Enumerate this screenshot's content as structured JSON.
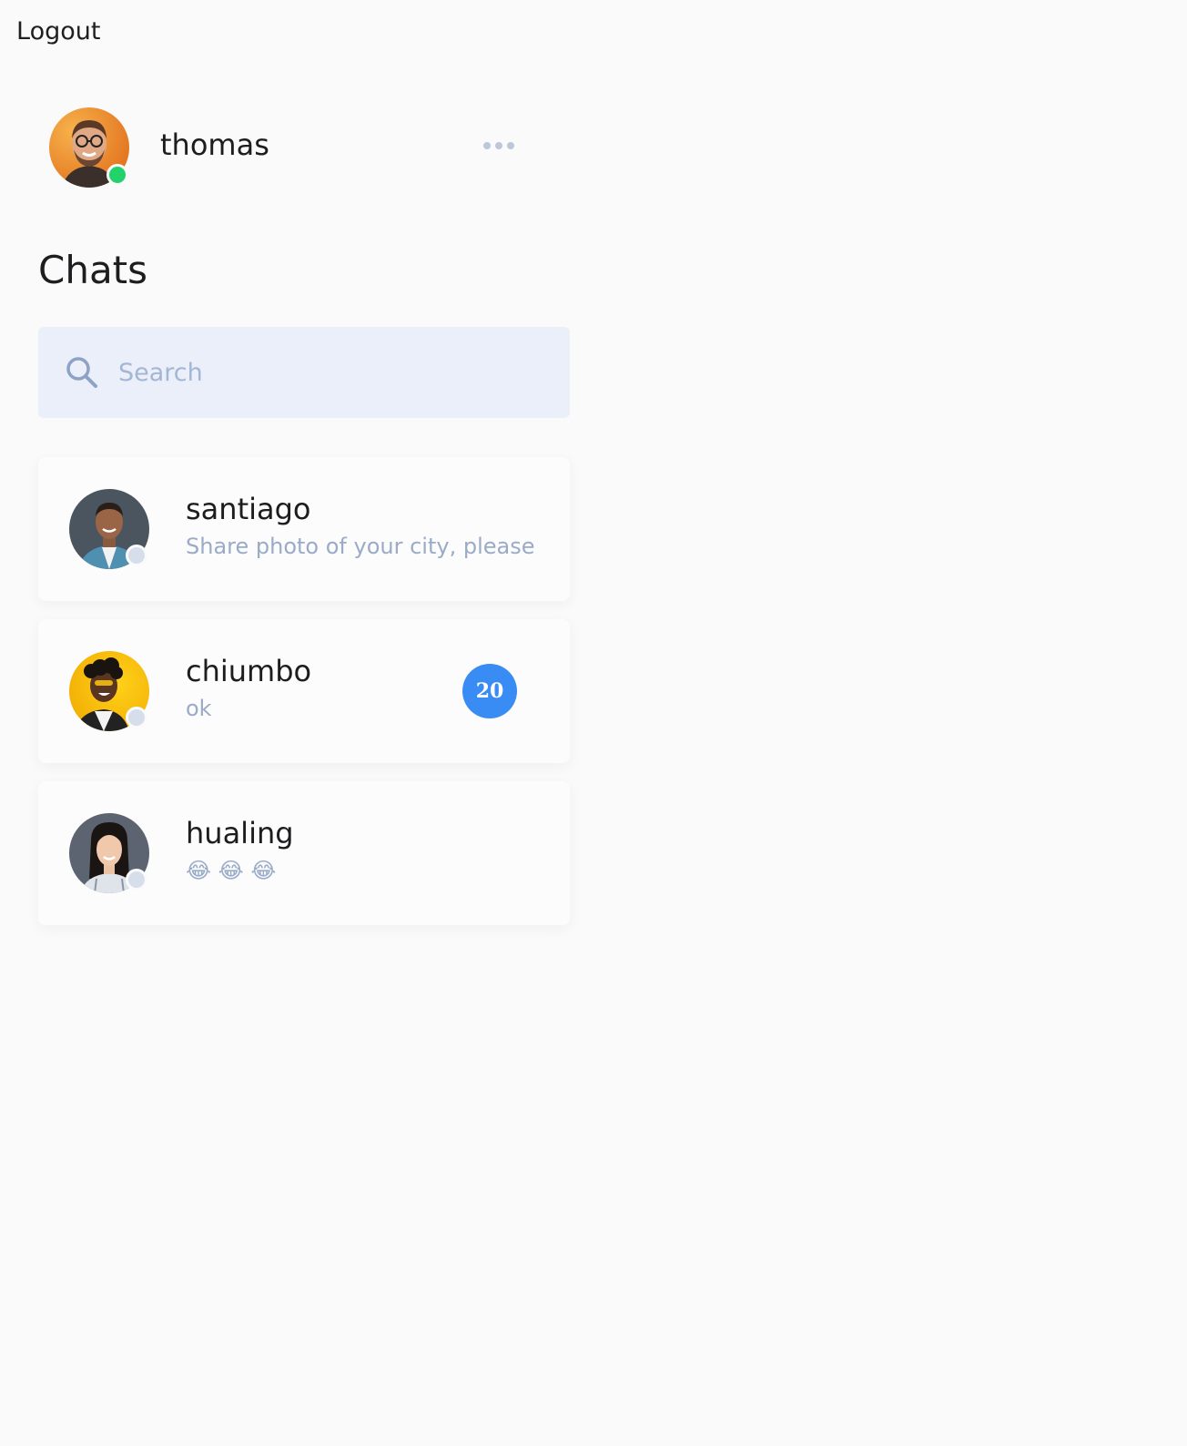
{
  "header": {
    "logout_label": "Logout"
  },
  "profile": {
    "name": "thomas",
    "status": "online",
    "status_color": "#22d36c"
  },
  "chats_title": "Chats",
  "search": {
    "placeholder": "Search",
    "value": ""
  },
  "chats": [
    {
      "name": "santiago",
      "last_message": "Share photo of your city, please",
      "unread": null,
      "status": "offline"
    },
    {
      "name": "chiumbo",
      "last_message": "ok",
      "unread": "20",
      "status": "offline"
    },
    {
      "name": "hualing",
      "last_message": "😂 😂 😂",
      "unread": null,
      "status": "offline"
    }
  ],
  "colors": {
    "accent": "#3a8cf5",
    "search_bg": "#eaeff9",
    "muted_text": "#9aabc8",
    "offline_dot": "#d6deec"
  }
}
